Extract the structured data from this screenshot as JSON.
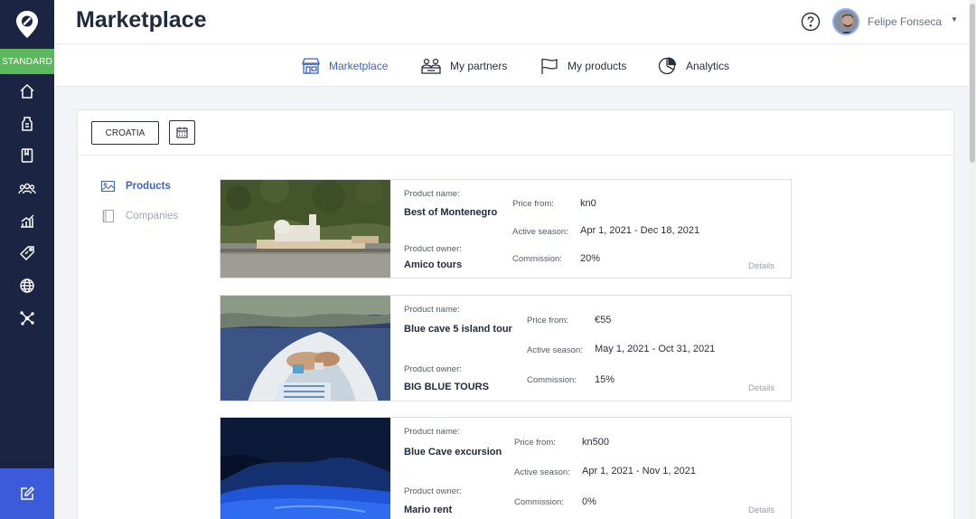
{
  "sidebar": {
    "plan_label": "STANDARD",
    "icons": [
      "home-icon",
      "clothing-icon",
      "book-icon",
      "users-icon",
      "stats-icon",
      "tag-icon",
      "globe-icon",
      "network-icon"
    ],
    "bottom_icon": "edit-icon",
    "active_color": "#3b5bdb",
    "badge_color": "#5cb85c"
  },
  "header": {
    "title": "Marketplace",
    "user_name": "Felipe Fonseca"
  },
  "tabs": [
    {
      "label": "Marketplace",
      "icon": "store-icon",
      "active": true
    },
    {
      "label": "My partners",
      "icon": "partners-icon",
      "active": false
    },
    {
      "label": "My products",
      "icon": "flag-icon",
      "active": false
    },
    {
      "label": "Analytics",
      "icon": "pie-chart-icon",
      "active": false
    }
  ],
  "filters": {
    "country": "CROATIA",
    "calendar_icon": "calendar-icon"
  },
  "side_nav": [
    {
      "label": "Products",
      "icon": "image-icon",
      "active": true
    },
    {
      "label": "Companies",
      "icon": "notebook-icon",
      "active": false
    }
  ],
  "labels": {
    "product_name": "Product name:",
    "product_owner": "Product owner:",
    "price_from": "Price from:",
    "active_season": "Active season:",
    "commission": "Commission:",
    "details": "Details"
  },
  "products": [
    {
      "name": "Best of Montenegro",
      "owner": "Amico tours",
      "price_from": "kn0",
      "active_season": "Apr 1, 2021 - Dec 18, 2021",
      "commission": "20%"
    },
    {
      "name": "Blue cave 5 island tour",
      "owner": "BIG BLUE TOURS",
      "price_from": "€55",
      "active_season": "May 1, 2021 - Oct 31, 2021",
      "commission": "15%"
    },
    {
      "name": "Blue Cave excursion",
      "owner": "Mario rent",
      "price_from": "kn500",
      "active_season": "Apr 1, 2021 - Nov 1, 2021",
      "commission": "0%"
    }
  ]
}
